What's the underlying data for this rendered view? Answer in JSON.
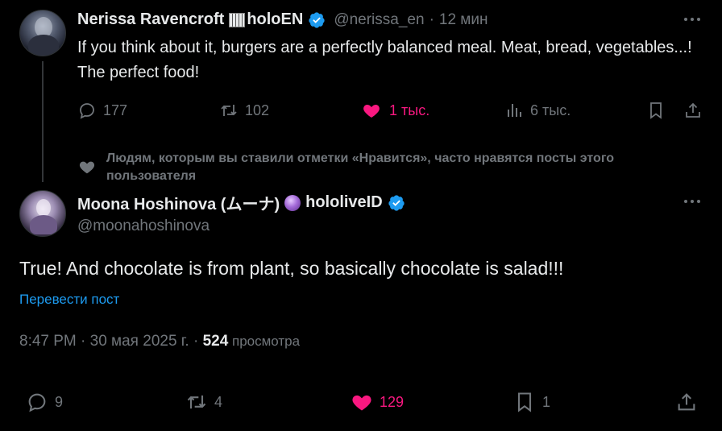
{
  "reply_parent": {
    "author_name": "Nerissa Ravencroft",
    "author_org": "holoEN",
    "handle": "@nerissa_en",
    "separator": "·",
    "time": "12 мин",
    "text": "If you think about it, burgers are a perfectly balanced meal. Meat, bread, vegetables...! The perfect food!",
    "stats": {
      "replies": "177",
      "retweets": "102",
      "likes": "1 тыс.",
      "views": "6 тыс."
    }
  },
  "suggestion": {
    "text": "Людям, которым вы ставили отметки «Нравится», часто нравятся посты этого пользователя"
  },
  "main_tweet": {
    "author_name": "Moona Hoshinova (ムーナ)",
    "author_org": "hololiveID",
    "handle": "@moonahoshinova",
    "text": "True! And chocolate is from plant, so basically chocolate is salad!!!",
    "translate_label": "Перевести пост",
    "timestamp": "8:47 PM · 30 мая 2025 г. · ",
    "views_count": "524",
    "views_label": " просмотра",
    "stats": {
      "replies": "9",
      "retweets": "4",
      "likes": "129",
      "bookmarks": "1"
    }
  },
  "colors": {
    "background": "#000000",
    "text": "#e7e9ea",
    "muted": "#71767b",
    "like": "#f91880",
    "link": "#1d9bf0",
    "verified": "#1d9bf0"
  }
}
